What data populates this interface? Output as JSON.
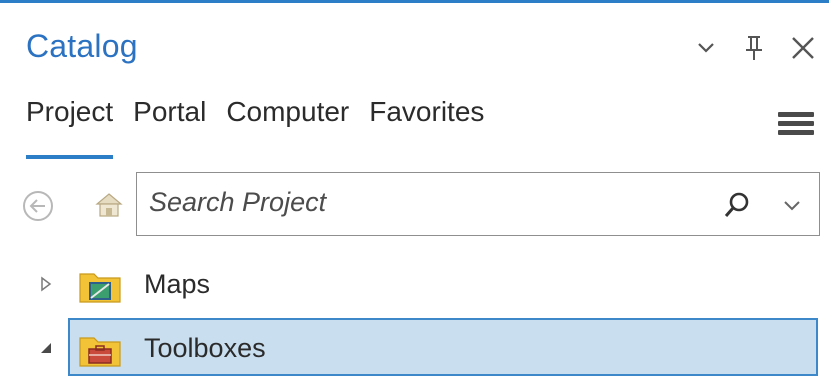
{
  "pane": {
    "title": "Catalog",
    "controls": {
      "options_icon": "chevron-down-icon",
      "pin_icon": "pin-icon",
      "close_icon": "close-icon"
    }
  },
  "tabs": [
    {
      "label": "Project",
      "active": true
    },
    {
      "label": "Portal",
      "active": false
    },
    {
      "label": "Computer",
      "active": false
    },
    {
      "label": "Favorites",
      "active": false
    }
  ],
  "toolbar": {
    "back_icon": "back-arrow-icon",
    "home_icon": "home-icon",
    "menu_icon": "hamburger-menu-icon"
  },
  "search": {
    "placeholder": "Search Project",
    "icon": "search-icon",
    "dropdown_icon": "chevron-down-icon"
  },
  "tree": {
    "items": [
      {
        "label": "Maps",
        "expanded": false,
        "selected": false,
        "icon": "maps-folder-icon"
      },
      {
        "label": "Toolboxes",
        "expanded": true,
        "selected": true,
        "icon": "toolboxes-folder-icon"
      }
    ]
  },
  "colors": {
    "accent": "#2c7fc6",
    "title": "#2b73c2",
    "selection_bg": "#c9deef",
    "selection_border": "#3c88c9"
  }
}
